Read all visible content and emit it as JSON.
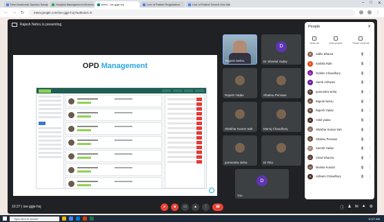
{
  "browser": {
    "tabs": [
      {
        "label": "New Bookmark Species Sample",
        "color": "#4285f4"
      },
      {
        "label": "Hospital Management Information",
        "color": "#34a853"
      },
      {
        "label": "Meet - ioe-ggje-hxj",
        "color": "#00897b",
        "active": true
      },
      {
        "label": "Live of Patient Registration",
        "color": "#4285f4"
      },
      {
        "label": "Live of Patient Search Hos Sale",
        "color": "#4285f4"
      }
    ],
    "url": "meet.google.com/ioe-ggje-hxj?authuser=0"
  },
  "meet": {
    "presenting_label": "Rajesh Nehru is presenting",
    "slide": {
      "title_part1": "OPD",
      "title_part2": "Management",
      "accent": "#29a8e0"
    },
    "tiles": [
      {
        "name": "Rajesh Nehru",
        "type": "camera"
      },
      {
        "name": "Dr Sheetal Yadav",
        "type": "initial",
        "initial": "D",
        "color": "#5e35b1"
      },
      {
        "name": "Rajesh Yadav",
        "type": "photo"
      },
      {
        "name": "Shabnu Pervaan",
        "type": "photo"
      },
      {
        "name": "Shekhar Kumar Sah",
        "type": "photo"
      },
      {
        "name": "Manoj Chaudhary",
        "type": "photo"
      },
      {
        "name": "purnendra sinha",
        "type": "photo"
      },
      {
        "name": "Dr Ritu",
        "type": "photo"
      },
      {
        "name": "You",
        "type": "initial",
        "initial": "D",
        "color": "#5e35b1"
      }
    ],
    "time_label": "10:27 | ioe-ggje-hxj"
  },
  "people": {
    "title": "People",
    "actions": [
      "Mute all",
      "Add people",
      "Share controls"
    ],
    "participants": [
      {
        "name": "Sidhu Bhanot",
        "initial": "S",
        "color": "#8d6e63"
      },
      {
        "name": "Sushila Rath",
        "initial": "S",
        "color": "#e64a19"
      },
      {
        "name": "Golden Chowdhury",
        "initial": "G",
        "color": "#7b1fa2"
      },
      {
        "name": "Harsh Ashwani",
        "initial": "H",
        "color": "#6a1b9a"
      },
      {
        "name": "purnendra sinha",
        "initial": "P",
        "color": "#5d4037"
      },
      {
        "name": "Rajesh Nehru",
        "initial": "R",
        "color": "#795548"
      },
      {
        "name": "Rajesh Yadav",
        "initial": "R",
        "color": "#6d4c41"
      },
      {
        "name": "Ankit yadav",
        "initial": "A",
        "color": "#4e342e"
      },
      {
        "name": "Shekhar Kumar Sah",
        "initial": "S",
        "color": "#8d6e63"
      },
      {
        "name": "Shabnu Pervaan",
        "initial": "S",
        "color": "#6d4c41"
      },
      {
        "name": "Suresh Yadav",
        "initial": "S",
        "color": "#a1887f"
      },
      {
        "name": "Vinod Sharma",
        "initial": "V",
        "color": "#5d4037"
      },
      {
        "name": "Monika Kumari",
        "initial": "M",
        "color": "#795548"
      },
      {
        "name": "Ashwini Chowdhury",
        "initial": "A",
        "color": "#4e342e"
      }
    ]
  },
  "taskbar": {
    "search_placeholder": "Type here to search",
    "clock": "10:27 AM"
  }
}
